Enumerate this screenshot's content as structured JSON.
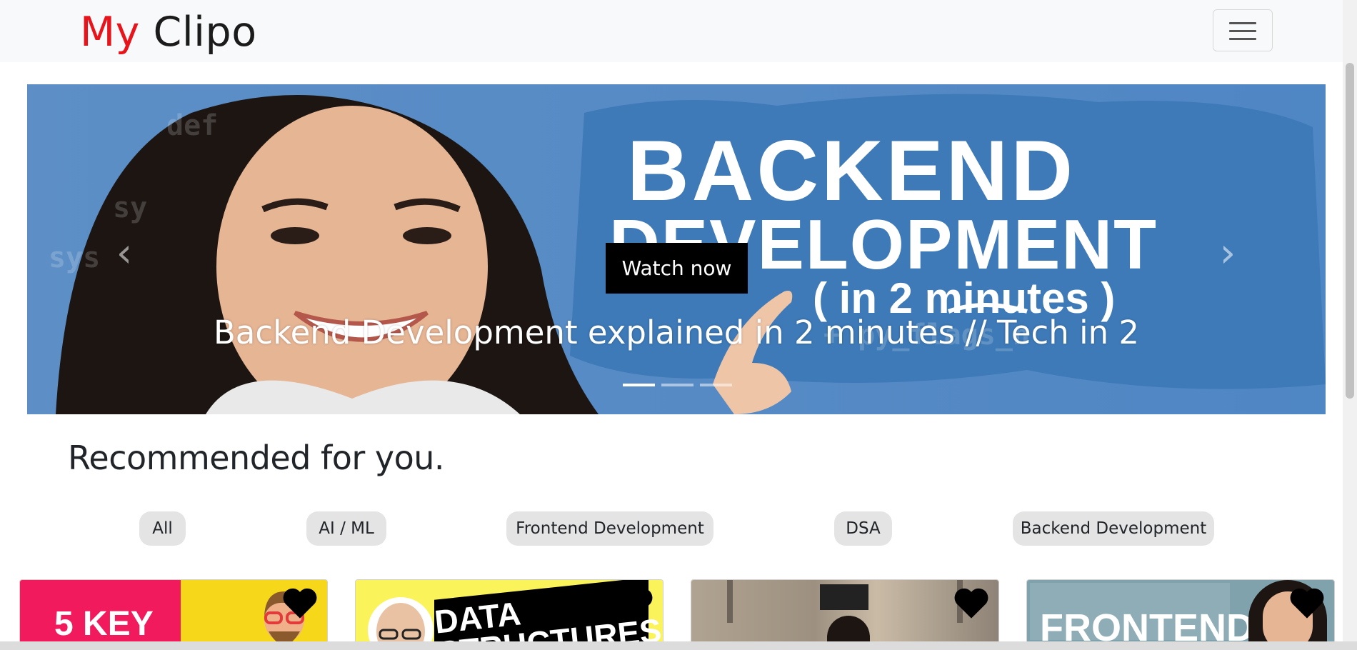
{
  "navbar": {
    "brand_my": "My",
    "brand_clipo": "Clipo",
    "menu_icon": "hamburger-icon"
  },
  "hero": {
    "thumbnail_text": {
      "line1": "BACKEND",
      "line2": "DEVELOPMENT",
      "line3": "( in 2 minutes )"
    },
    "watch_button": "Watch now",
    "caption": "Backend Development explained in 2 minutes // Tech in 2",
    "slide_count": 3,
    "active_slide": 1,
    "prev_icon": "chevron-left-icon",
    "next_icon": "chevron-right-icon"
  },
  "recommended": {
    "title": "Recommended for you."
  },
  "filters": [
    "All",
    "AI / ML",
    "Frontend Development",
    "DSA",
    "Backend Development"
  ],
  "cards": [
    {
      "thumb_text": "5 KEY",
      "bg_left": "#f01a5c",
      "bg_right": "#f7d71a",
      "favorite_icon": "heart-icon"
    },
    {
      "thumb_text": "DATA STRUCTURES",
      "bg_left": "#fbf35a",
      "bg_right": "#fbf35a",
      "favorite_icon": "heart-icon"
    },
    {
      "thumb_text": "",
      "bg_left": "#a79a88",
      "bg_right": "#8d8276",
      "favorite_icon": "heart-icon"
    },
    {
      "thumb_text": "FRONTEND",
      "bg_left": "#6f9aa8",
      "bg_right": "#86a9b3",
      "favorite_icon": "heart-icon"
    }
  ],
  "colors": {
    "brand_red": "#e8141c",
    "hero_blue": "#4d86c2",
    "pill_bg": "#e4e4e4",
    "navbar_bg": "#f8f9fa"
  }
}
